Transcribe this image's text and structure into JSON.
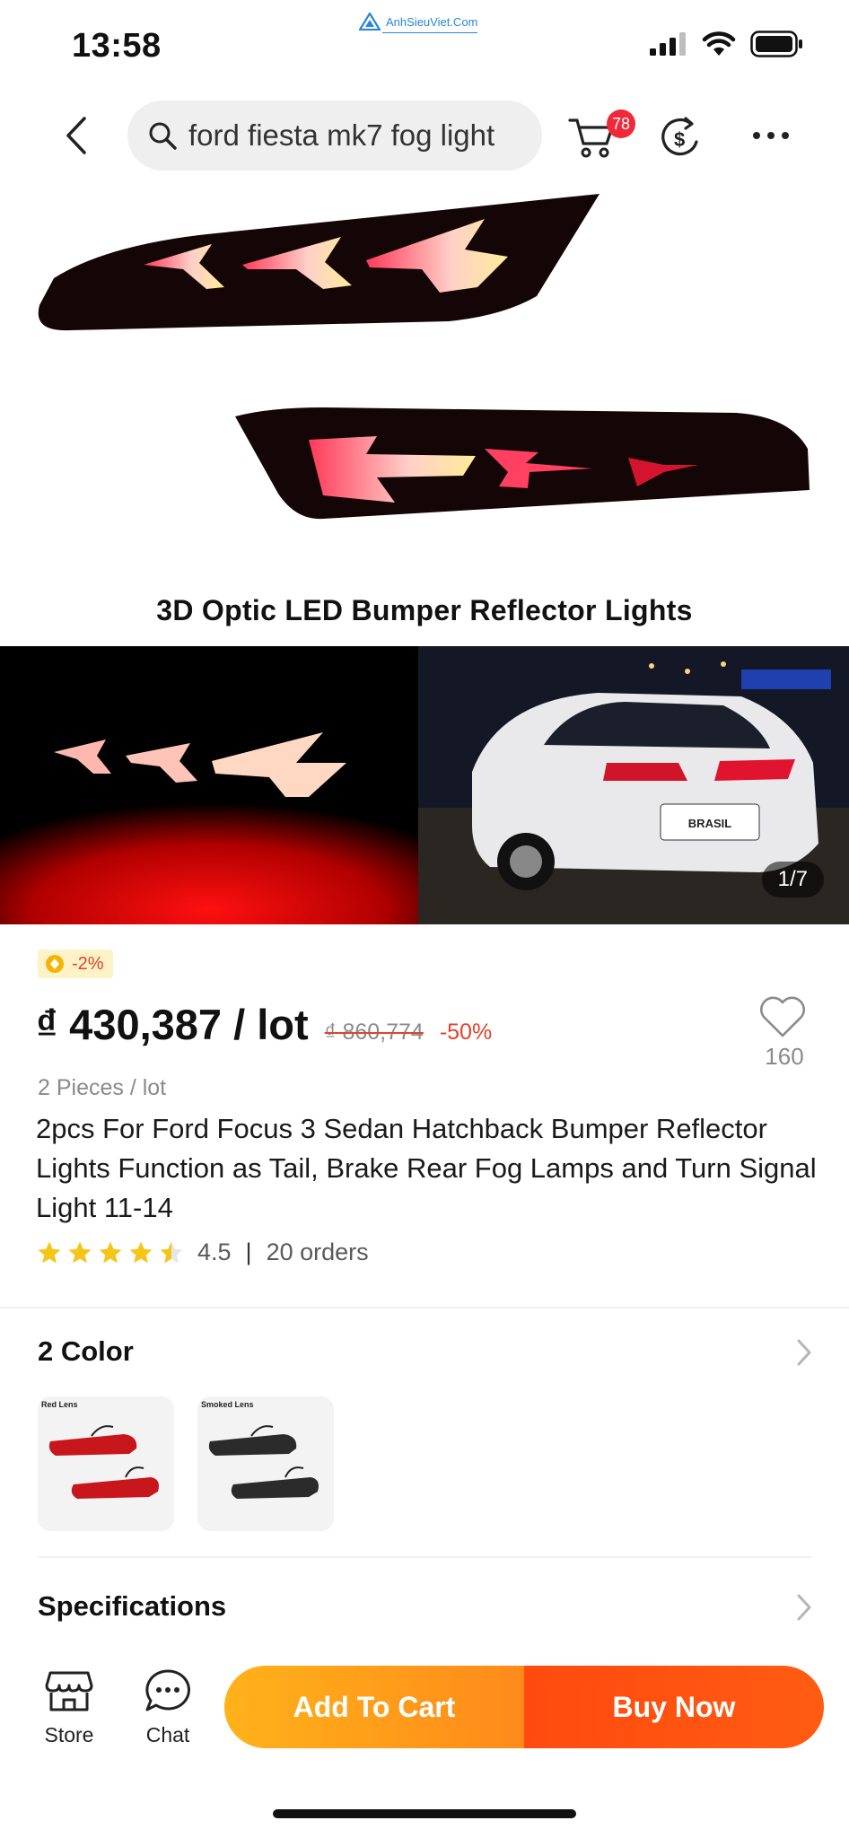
{
  "status_bar": {
    "time": "13:58",
    "watermark": "AnhSieuViet.Com",
    "icons": [
      "signal-icon",
      "wifi-icon",
      "battery-icon"
    ]
  },
  "search": {
    "query": "ford fiesta mk7 fog light",
    "cart_badge": "78",
    "icons": [
      "back-icon",
      "search-icon",
      "cart-icon",
      "coin-icon",
      "more-icon"
    ]
  },
  "gallery": {
    "caption": "3D Optic LED Bumper Reflector Lights",
    "counter": "1/7",
    "plate_text": "BRASIL"
  },
  "product": {
    "discount_chip": "-2%",
    "price": "₫ 430,387 / lot",
    "original_price": "₫ 860,774",
    "discount": "-50%",
    "wishlist_count": "160",
    "pieces": "2 Pieces / lot",
    "title": "2pcs For Ford Focus 3 Sedan Hatchback Bumper Reflector Lights Function as Tail, Brake Rear Fog Lamps and Turn Signal Light 11-14",
    "rating_value": 4.5,
    "rating": "4.5",
    "orders": "20 orders"
  },
  "color_section": {
    "title": "2 Color",
    "swatches": [
      {
        "label": "Red Lens",
        "color": "#c8161d"
      },
      {
        "label": "Smoked Lens",
        "color": "#2b2b2b"
      }
    ]
  },
  "specs_section": {
    "title": "Specifications"
  },
  "bottom_bar": {
    "store": "Store",
    "chat": "Chat",
    "add_to_cart": "Add To Cart",
    "buy_now": "Buy Now"
  },
  "colors": {
    "accent_red": "#e0432b",
    "badge_red": "#f0283a",
    "cart_orange": "#ffa31a",
    "buy_orange": "#ff4f10",
    "star_yellow": "#f5c518"
  }
}
